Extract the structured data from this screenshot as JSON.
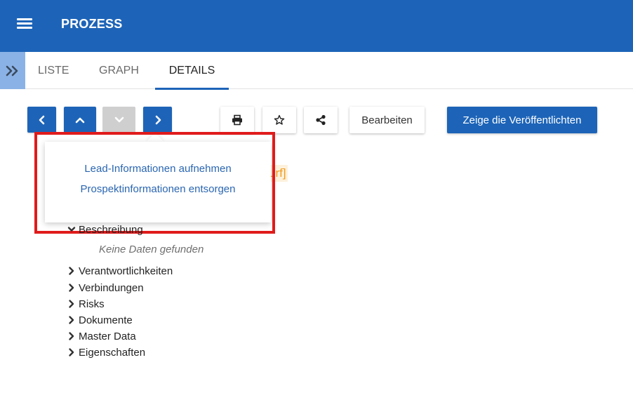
{
  "header": {
    "title": "PROZESS",
    "menu_icon": "hamburger-menu-icon"
  },
  "tabs": {
    "expand_icon": "double-chevron-right-icon",
    "items": [
      {
        "label": "LISTE",
        "active": false
      },
      {
        "label": "GRAPH",
        "active": false
      },
      {
        "label": "DETAILS",
        "active": true
      }
    ]
  },
  "toolbar": {
    "nav_icons": [
      "chevron-left-icon",
      "chevron-up-icon",
      "chevron-down-icon",
      "chevron-right-icon"
    ],
    "down_disabled": true,
    "tool_icons": [
      "print-icon",
      "star-icon",
      "share-icon"
    ],
    "edit_label": "Bearbeiten",
    "publish_label": "Zeige die Veröffentlichten"
  },
  "status_fragment": "urf]",
  "popup": {
    "items": [
      "Lead-Informationen aufnehmen",
      "Prospektinformationen entsorgen"
    ]
  },
  "sections": {
    "expanded": {
      "label": "Beschreibung",
      "empty_text": "Keine Daten gefunden"
    },
    "collapsed": [
      "Verantwortlichkeiten",
      "Verbindungen",
      "Risks",
      "Dokumente",
      "Master Data",
      "Eigenschaften"
    ]
  },
  "colors": {
    "primary": "#1d64b8",
    "accent_light": "#8ab2e6",
    "disabled": "#cfcfcf",
    "status_orange": "#f29c1f",
    "highlight_red": "#e01b1b",
    "link": "#2a66b1"
  }
}
